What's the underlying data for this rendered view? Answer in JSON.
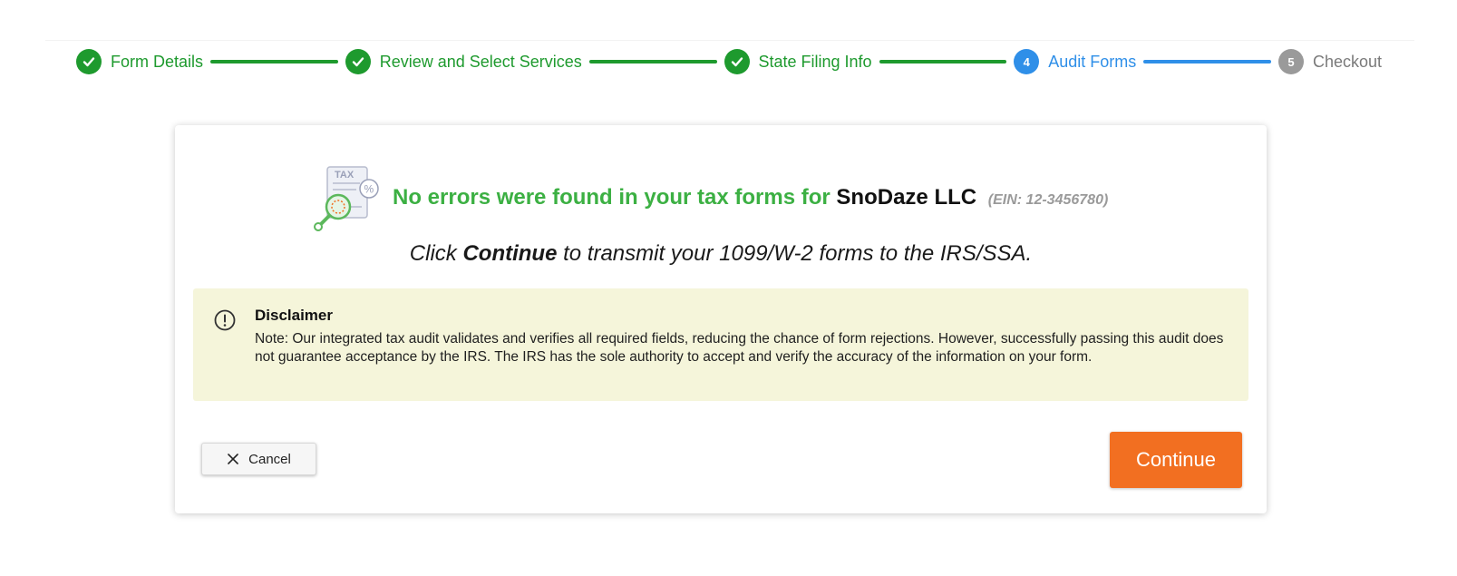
{
  "stepper": {
    "steps": [
      {
        "label": "Form Details",
        "status": "done",
        "number": ""
      },
      {
        "label": "Review and Select Services",
        "status": "done",
        "number": ""
      },
      {
        "label": "State Filing Info",
        "status": "done",
        "number": ""
      },
      {
        "label": "Audit Forms",
        "status": "active",
        "number": "4"
      },
      {
        "label": "Checkout",
        "status": "pending",
        "number": "5"
      }
    ]
  },
  "result": {
    "message": "No errors were found in your tax forms for",
    "company": "SnoDaze LLC",
    "ein": "(EIN: 12-3456780)",
    "illustration_label": "TAX"
  },
  "instruction": {
    "prefix": "Click",
    "emphasis": "Continue",
    "suffix": "to transmit your 1099/W-2 forms to the IRS/SSA."
  },
  "disclaimer": {
    "title": "Disclaimer",
    "note_label": "Note:",
    "body": "Our integrated tax audit validates and verifies all required fields, reducing the chance of form rejections. However, successfully passing this audit does not guarantee acceptance by the IRS. The IRS has the sole authority to accept and verify the accuracy of the information on your form."
  },
  "actions": {
    "cancel_label": "Cancel",
    "continue_label": "Continue"
  },
  "colors": {
    "done": "#1e9a2e",
    "active": "#2f8fe8",
    "pending": "#9a9a9a",
    "success_text": "#3cb043",
    "continue_button": "#f26f21",
    "disclaimer_bg": "#f5f5da"
  },
  "icons": {
    "step_done": "checkmark-icon",
    "disclaimer": "alert-circle-icon",
    "cancel": "close-icon",
    "illustration": "tax-document-magnifier-icon"
  }
}
